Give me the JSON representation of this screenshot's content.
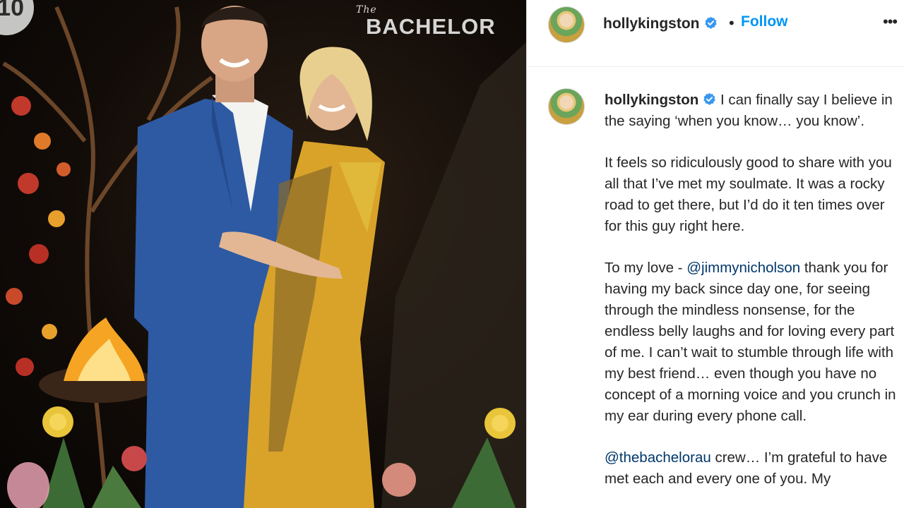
{
  "photo": {
    "watermark_text": "10",
    "show_logo": {
      "prefix": "The",
      "name": "BACHELOR"
    }
  },
  "header": {
    "username": "hollykingston",
    "separator": "•",
    "follow_label": "Follow",
    "more_label": "•••"
  },
  "post": {
    "username": "hollykingston",
    "p1": "I can finally say I believe in the saying ‘when you know… you know’.",
    "p2": "It feels so ridiculously good to share with you all that I’ve met my soulmate. It was a rocky road to get there, but I’d do it ten times over for this guy right here.",
    "p3_prefix": "To my love - ",
    "p3_mention": "@jimmynicholson",
    "p3_rest": " thank you for having my back since day one, for seeing through the mindless nonsense, for the endless belly laughs and for loving every part of me. I can’t wait to stumble through life with my best friend… even though you have no concept of a morning voice and you crunch in my ear during every phone call.",
    "p4_mention": "@thebachelorau",
    "p4_rest": " crew… I’m grateful to have met each and every one of you. My"
  },
  "colors": {
    "accent": "#0095f6",
    "mention": "#00376b",
    "text": "#262626",
    "verified": "#3897f0"
  },
  "icons": {
    "verified": "verified-badge-icon",
    "more": "more-options-icon"
  }
}
